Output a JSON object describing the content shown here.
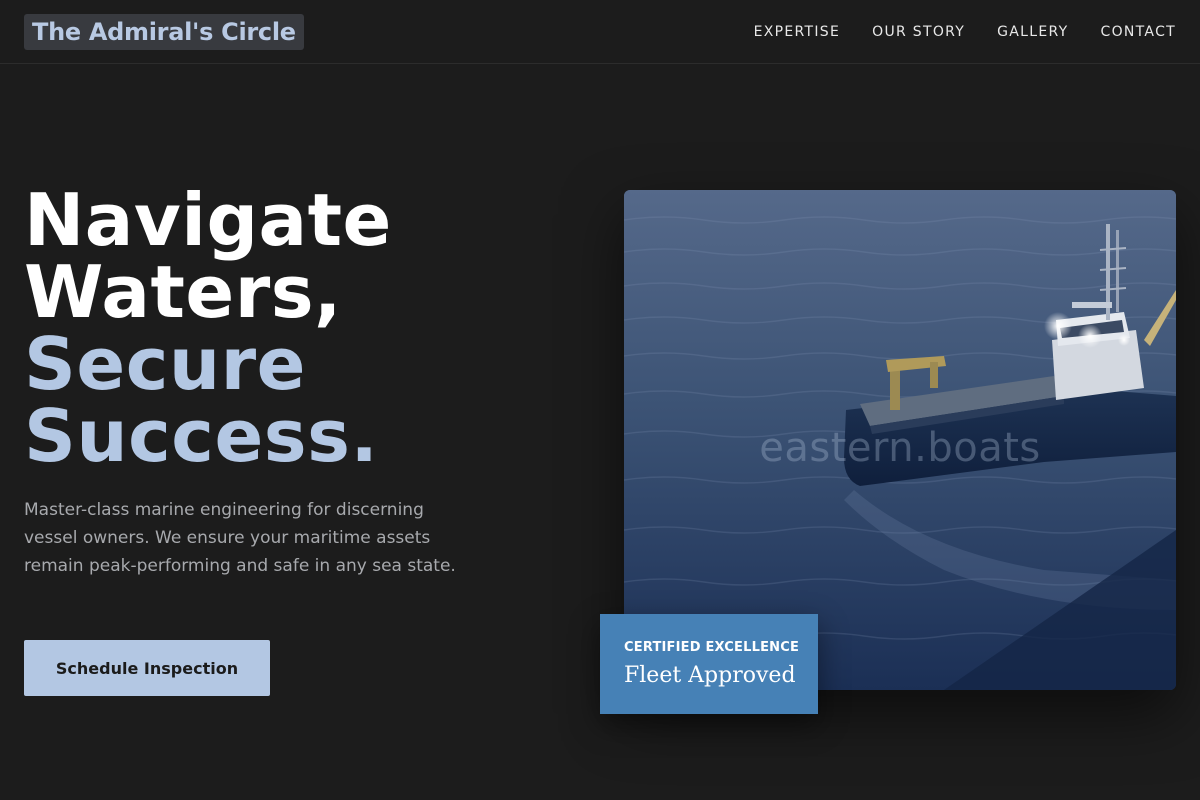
{
  "header": {
    "logo_text": "The Admiral's Circle",
    "nav": [
      {
        "label": "EXPERTISE"
      },
      {
        "label": "OUR STORY"
      },
      {
        "label": "GALLERY"
      },
      {
        "label": "CONTACT"
      }
    ]
  },
  "hero": {
    "headline": {
      "line1": "Navigate",
      "line2": "Waters,",
      "line3": "Secure",
      "line4": "Success."
    },
    "description": "Master-class marine engineering for discerning vessel owners. We ensure your maritime assets remain peak-performing and safe in any sea state.",
    "cta_label": "Schedule Inspection",
    "image": {
      "subject": "workboat-at-sea-photo",
      "watermark": "eastern.boats"
    },
    "badge": {
      "eyebrow": "CERTIFIED EXCELLENCE",
      "title": "Fleet Approved"
    }
  },
  "colors": {
    "background": "#1c1c1c",
    "accent": "#b3c7e3",
    "badge": "#4681b6",
    "body_text": "#a7a9ad"
  }
}
